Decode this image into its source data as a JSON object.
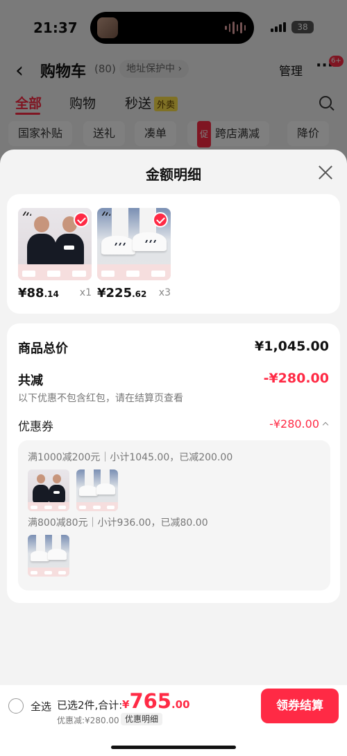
{
  "status": {
    "time": "21:37",
    "battery": "38"
  },
  "nav": {
    "title": "购物车",
    "count": "(80)",
    "address_protect": "地址保护中 ›",
    "manage": "管理",
    "more_badge": "6+"
  },
  "tabs": [
    {
      "label": "全部"
    },
    {
      "label": "购物"
    },
    {
      "label": "秒送",
      "tag": "外卖"
    }
  ],
  "chips": [
    {
      "label": "国家补贴"
    },
    {
      "label": "送礼"
    },
    {
      "label": "凑单"
    },
    {
      "label": "跨店满减",
      "icon_text": "促"
    },
    {
      "label": "降价"
    }
  ],
  "sheet": {
    "title": "金额明细",
    "products": [
      {
        "price_int": "¥88",
        "price_dec": ".14",
        "qty": "x1",
        "kind": "shirt"
      },
      {
        "price_int": "¥225",
        "price_dec": ".62",
        "qty": "x3",
        "kind": "shoe"
      }
    ],
    "summary": {
      "total_label": "商品总价",
      "total_value": "¥1,045.00",
      "reduce_label": "共减",
      "reduce_value": "-¥280.00",
      "note": "以下优惠不包含红包，请在结算页查看",
      "coupon_label": "优惠券",
      "coupon_value": "-¥280.00"
    },
    "coupon_details": [
      {
        "text": "满1000减200元｜小计1045.00，已减200.00"
      },
      {
        "text": "满800减80元｜小计936.00，已减80.00"
      }
    ]
  },
  "bottom": {
    "select_all": "全选",
    "selected": "已选2件,合计:",
    "price_yen": "¥",
    "price_int": "765",
    "price_dec": ".00",
    "discount": "优惠减:¥280.00",
    "detail_button": "优惠明细",
    "checkout": "领券结算"
  },
  "colors": {
    "accent": "#ff2a45",
    "tag_yellow": "#ffe24a"
  }
}
